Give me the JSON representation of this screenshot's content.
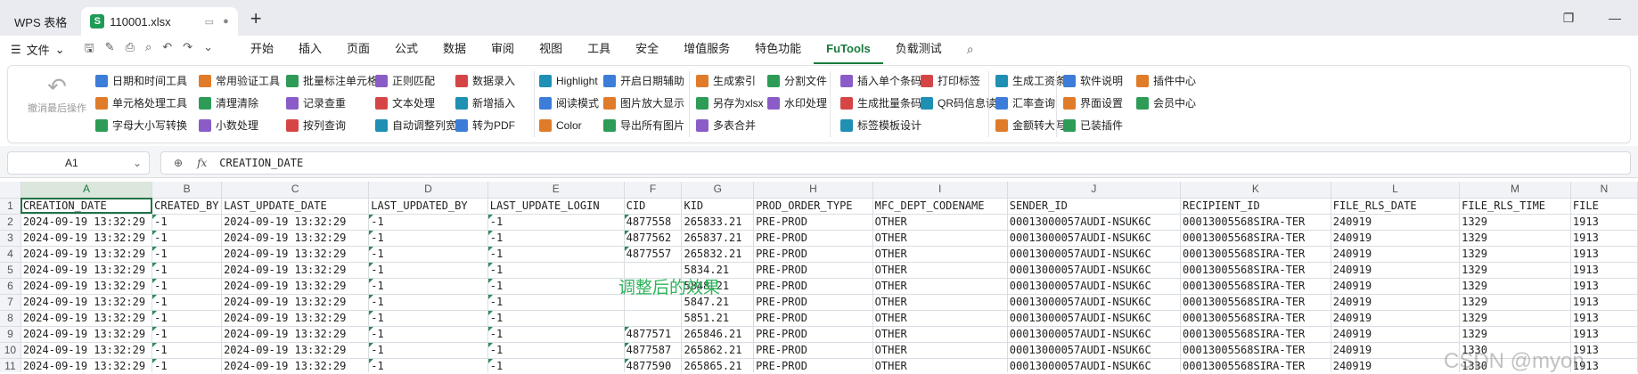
{
  "window": {
    "app_tab": "WPS 表格",
    "file_tab": "110001.xlsx",
    "file_icon_letter": "S",
    "new_tab": "+"
  },
  "menu": {
    "file_label": "文件",
    "tabs": [
      "开始",
      "插入",
      "页面",
      "公式",
      "数据",
      "审阅",
      "视图",
      "工具",
      "安全",
      "增值服务",
      "特色功能",
      "FuTools",
      "负载测试"
    ],
    "active_tab": "FuTools"
  },
  "ribbon": {
    "undo_label": "撤消最后操作",
    "groups": [
      [
        "日期和时间工具",
        "单元格处理工具",
        "字母大小写转换"
      ],
      [
        "常用验证工具",
        "清理清除",
        "小数处理"
      ],
      [
        "批量标注单元格",
        "记录查重",
        "按列查询"
      ],
      [
        "正则匹配",
        "文本处理",
        "自动调整列宽"
      ],
      [
        "数据录入",
        "新增插入",
        "转为PDF"
      ],
      [
        "Highlight",
        "阅读模式",
        "Color"
      ],
      [
        "开启日期辅助",
        "图片放大显示",
        "导出所有图片"
      ],
      [
        "生成索引",
        "另存为xlsx",
        "多表合并"
      ],
      [
        "分割文件",
        "水印处理"
      ],
      [
        "插入单个条码",
        "生成批量条码",
        "标签模板设计"
      ],
      [
        "打印标签",
        "QR码信息读取"
      ],
      [
        "生成工资条",
        "汇率查询",
        "金额转大写"
      ],
      [
        "软件说明",
        "界面设置",
        "已装插件"
      ],
      [
        "插件中心",
        "会员中心"
      ]
    ]
  },
  "formula_bar": {
    "cell_ref": "A1",
    "fx": "fx",
    "formula": "CREATION_DATE"
  },
  "sheet": {
    "columns": [
      "A",
      "B",
      "C",
      "D",
      "E",
      "F",
      "G",
      "H",
      "I",
      "J",
      "K",
      "L",
      "M",
      "N"
    ],
    "rows": [
      [
        "CREATION_DATE",
        "CREATED_BY",
        "LAST_UPDATE_DATE",
        "LAST_UPDATED_BY",
        "LAST_UPDATE_LOGIN",
        "CID",
        "KID",
        "PROD_ORDER_TYPE",
        "MFC_DEPT_CODENAME",
        "SENDER_ID",
        "RECIPIENT_ID",
        "FILE_RLS_DATE",
        "FILE_RLS_TIME",
        "FILE"
      ],
      [
        "2024-09-19 13:32:29",
        "-1",
        "2024-09-19 13:32:29",
        "-1",
        "-1",
        "4877558",
        "265833.21",
        "PRE-PROD",
        "OTHER",
        "00013000057AUDI-NSUK6C",
        "00013005568SIRA-TER",
        "240919",
        "1329",
        "1913"
      ],
      [
        "2024-09-19 13:32:29",
        "-1",
        "2024-09-19 13:32:29",
        "-1",
        "-1",
        "4877562",
        "265837.21",
        "PRE-PROD",
        "OTHER",
        "00013000057AUDI-NSUK6C",
        "00013005568SIRA-TER",
        "240919",
        "1329",
        "1913"
      ],
      [
        "2024-09-19 13:32:29",
        "-1",
        "2024-09-19 13:32:29",
        "-1",
        "-1",
        "4877557",
        "265832.21",
        "PRE-PROD",
        "OTHER",
        "00013000057AUDI-NSUK6C",
        "00013005568SIRA-TER",
        "240919",
        "1329",
        "1913"
      ],
      [
        "2024-09-19 13:32:29",
        "-1",
        "2024-09-19 13:32:29",
        "-1",
        "-1",
        "",
        "5834.21",
        "PRE-PROD",
        "OTHER",
        "00013000057AUDI-NSUK6C",
        "00013005568SIRA-TER",
        "240919",
        "1329",
        "1913"
      ],
      [
        "2024-09-19 13:32:29",
        "-1",
        "2024-09-19 13:32:29",
        "-1",
        "-1",
        "",
        "5848.21",
        "PRE-PROD",
        "OTHER",
        "00013000057AUDI-NSUK6C",
        "00013005568SIRA-TER",
        "240919",
        "1329",
        "1913"
      ],
      [
        "2024-09-19 13:32:29",
        "-1",
        "2024-09-19 13:32:29",
        "-1",
        "-1",
        "",
        "5847.21",
        "PRE-PROD",
        "OTHER",
        "00013000057AUDI-NSUK6C",
        "00013005568SIRA-TER",
        "240919",
        "1329",
        "1913"
      ],
      [
        "2024-09-19 13:32:29",
        "-1",
        "2024-09-19 13:32:29",
        "-1",
        "-1",
        "",
        "5851.21",
        "PRE-PROD",
        "OTHER",
        "00013000057AUDI-NSUK6C",
        "00013005568SIRA-TER",
        "240919",
        "1329",
        "1913"
      ],
      [
        "2024-09-19 13:32:29",
        "-1",
        "2024-09-19 13:32:29",
        "-1",
        "-1",
        "4877571",
        "265846.21",
        "PRE-PROD",
        "OTHER",
        "00013000057AUDI-NSUK6C",
        "00013005568SIRA-TER",
        "240919",
        "1329",
        "1913"
      ],
      [
        "2024-09-19 13:32:29",
        "-1",
        "2024-09-19 13:32:29",
        "-1",
        "-1",
        "4877587",
        "265862.21",
        "PRE-PROD",
        "OTHER",
        "00013000057AUDI-NSUK6C",
        "00013005568SIRA-TER",
        "240919",
        "1330",
        "1913"
      ],
      [
        "2024-09-19 13:32:29",
        "-1",
        "2024-09-19 13:32:29",
        "-1",
        "-1",
        "4877590",
        "265865.21",
        "PRE-PROD",
        "OTHER",
        "00013000057AUDI-NSUK6C",
        "00013005568SIRA-TER",
        "240919",
        "1330",
        "1913"
      ]
    ]
  },
  "overlay_text": "调整后的效果",
  "watermark": "CSDN @myon",
  "colors": {
    "accent": "#1a7a3e",
    "overlay": "#2db35a",
    "selection": "#217346"
  }
}
